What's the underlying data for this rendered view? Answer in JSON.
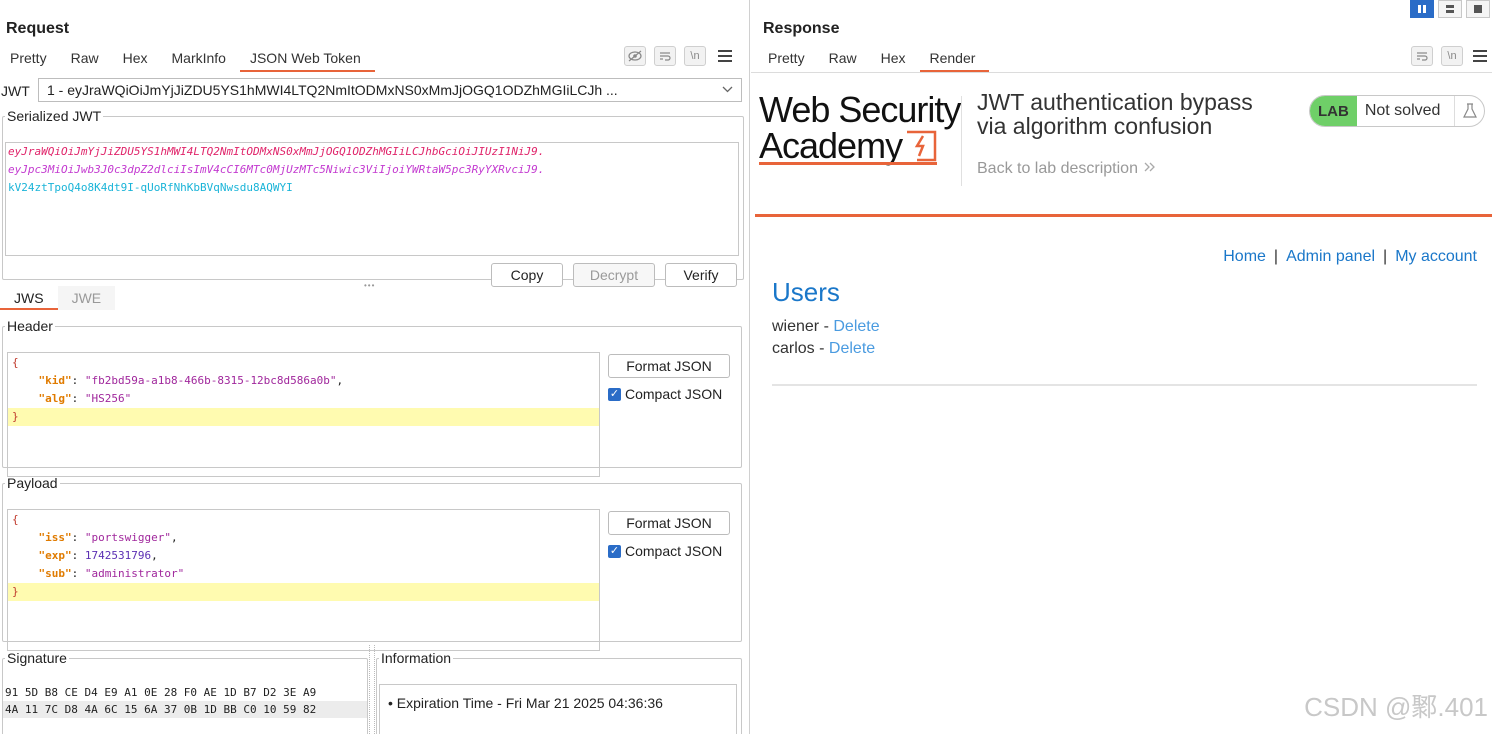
{
  "request": {
    "title": "Request",
    "tabs": [
      "Pretty",
      "Raw",
      "Hex",
      "MarkInfo",
      "JSON Web Token"
    ],
    "active_tab": "JSON Web Token",
    "icons": [
      "hide-icon",
      "wrap-icon",
      "newline-icon",
      "menu-icon"
    ],
    "jwt_label": "JWT",
    "jwt_selected": "1 - eyJraWQiOiJmYjJiZDU5YS1hMWI4LTQ2NmItODMxNS0xMmJjOGQ1ODZhMGIiLCJh ...",
    "serialized": {
      "legend": "Serialized JWT",
      "header_part": "eyJraWQiOiJmYjJiZDU5YS1hMWI4LTQ2NmItODMxNS0xMmJjOGQ1ODZhMGIiLCJhbGciOiJIUzI1NiJ9.",
      "payload_part": "eyJpc3MiOiJwb3J0c3dpZ2dlciIsImV4cCI6MTc0MjUzMTc5Niwic3ViIjoiYWRtaW5pc3RyYXRvciJ9.",
      "signature_part": "kV24ztTpoQ4o8K4dt9I-qUoRfNhKbBVqNwsdu8AQWYI",
      "copy_label": "Copy",
      "decrypt_label": "Decrypt",
      "verify_label": "Verify"
    },
    "jtabs": [
      "JWS",
      "JWE"
    ],
    "header": {
      "legend": "Header",
      "kid_key": "\"kid\"",
      "kid_value": "\"fb2bd59a-a1b8-466b-8315-12bc8d586a0b\"",
      "alg_key": "\"alg\"",
      "alg_value": "\"HS256\"",
      "format_label": "Format JSON",
      "compact_label": "Compact JSON"
    },
    "payload": {
      "legend": "Payload",
      "iss_key": "\"iss\"",
      "iss_value": "\"portswigger\"",
      "exp_key": "\"exp\"",
      "exp_value": "1742531796",
      "sub_key": "\"sub\"",
      "sub_value": "\"administrator\"",
      "format_label": "Format JSON",
      "compact_label": "Compact JSON"
    },
    "signature": {
      "legend": "Signature",
      "line1": "91 5D B8 CE D4 E9 A1 0E 28 F0 AE 1D B7 D2 3E A9",
      "line2": "4A 11 7C D8 4A 6C 15 6A 37 0B 1D BB C0 10 59 82"
    },
    "information": {
      "legend": "Information",
      "item": "Expiration Time - Fri Mar 21 2025 04:36:36"
    }
  },
  "response": {
    "title": "Response",
    "tabs": [
      "Pretty",
      "Raw",
      "Hex",
      "Render"
    ],
    "active_tab": "Render",
    "render": {
      "logo_line1": "Web Security",
      "logo_line2": "Academy",
      "lab_title_line1": "JWT authentication bypass",
      "lab_title_line2": "via algorithm confusion",
      "back_link": "Back to lab description",
      "lab_badge": "LAB",
      "lab_status": "Not solved",
      "nav": [
        "Home",
        "Admin panel",
        "My account"
      ],
      "nav_sep": "|",
      "users_title": "Users",
      "users": [
        {
          "name": "wiener",
          "action": "Delete"
        },
        {
          "name": "carlos",
          "action": "Delete"
        }
      ],
      "user_sep": " - "
    }
  },
  "watermark": "CSDN @鄹.401",
  "colors": {
    "accent": "#e8643a",
    "link": "#1a77c9",
    "lab_green": "#6fcf68",
    "checkbox": "#2a6cc7"
  }
}
